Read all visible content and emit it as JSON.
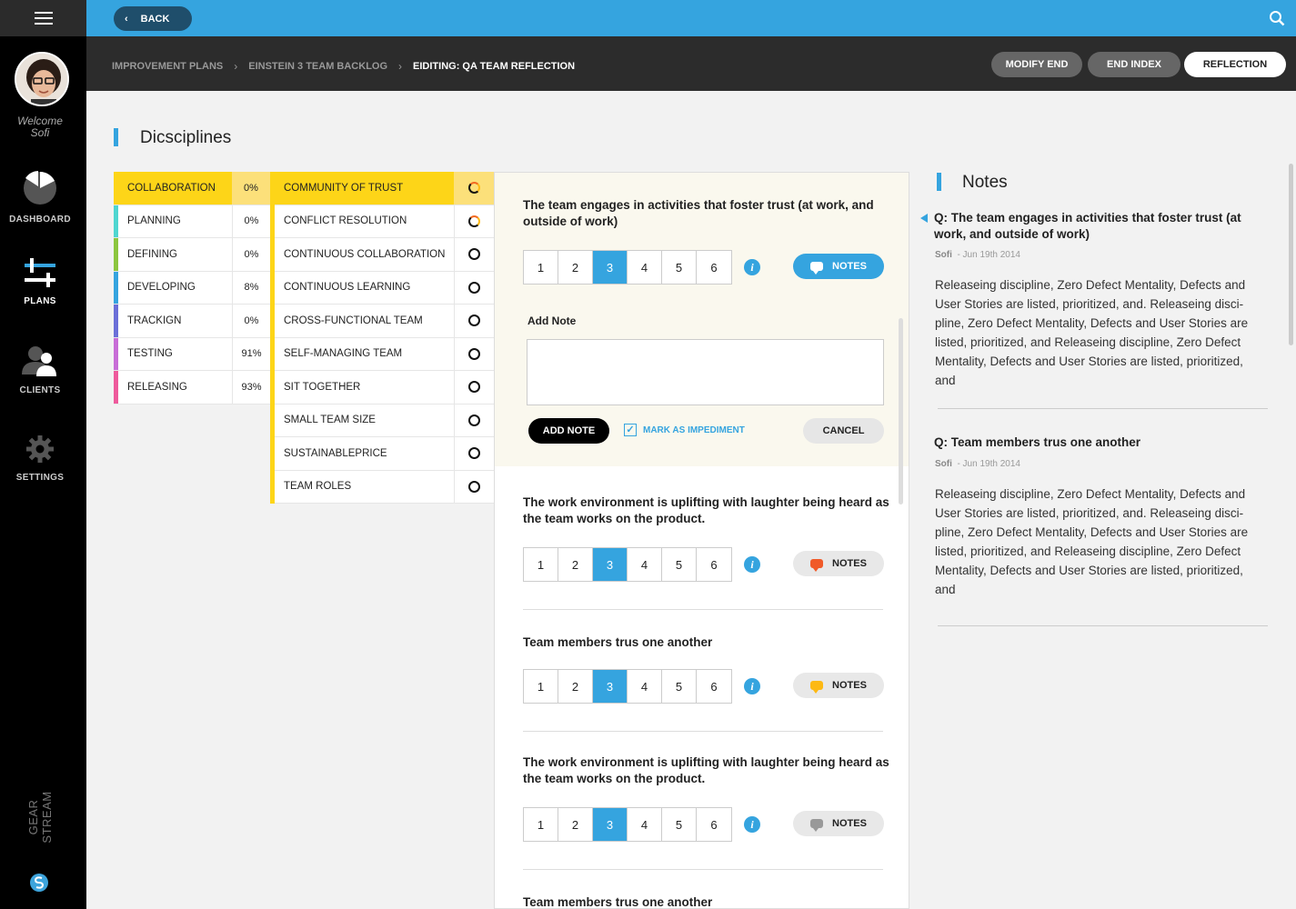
{
  "sidebar": {
    "welcome_line1": "Welcome",
    "welcome_line2": "Sofi",
    "items": [
      {
        "label": "DASHBOARD",
        "icon": "pie-chart-icon"
      },
      {
        "label": "PLANS",
        "icon": "sliders-icon",
        "active": true
      },
      {
        "label": "CLIENTS",
        "icon": "users-icon"
      },
      {
        "label": "SETTINGS",
        "icon": "gear-icon"
      }
    ],
    "brand": "GEAR STREAM"
  },
  "topbar": {
    "back_label": "BACK"
  },
  "breadcrumb": {
    "items": [
      "IMPROVEMENT PLANS",
      "EINSTEIN 3 TEAM BACKLOG",
      "EIDITING: QA TEAM REFLECTION"
    ]
  },
  "header_buttons": {
    "modify_end": "MODIFY END",
    "end_index": "END INDEX",
    "reflection": "REFLECTION"
  },
  "disciplines": {
    "title": "Dicsciplines",
    "items": [
      {
        "name": "COLLABORATION",
        "pct": "0%",
        "color": "#fdd518"
      },
      {
        "name": "PLANNING",
        "pct": "0%",
        "color": "#4fd6d0"
      },
      {
        "name": "DEFINING",
        "pct": "0%",
        "color": "#8cc63f"
      },
      {
        "name": "DEVELOPING",
        "pct": "8%",
        "color": "#35a4df"
      },
      {
        "name": "TRACKIGN",
        "pct": "0%",
        "color": "#6b6fd8"
      },
      {
        "name": "TESTING",
        "pct": "91%",
        "color": "#c86dd7"
      },
      {
        "name": "RELEASING",
        "pct": "93%",
        "color": "#ee5a9c"
      }
    ],
    "sub_items": [
      "COMMUNITY OF TRUST",
      "CONFLICT RESOLUTION",
      "CONTINUOUS COLLABORATION",
      "CONTINUOUS LEARNING",
      "CROSS-FUNCTIONAL TEAM",
      "SELF-MANAGING TEAM",
      "SIT TOGETHER",
      "SMALL TEAM SIZE",
      "SUSTAINABLEPRICE",
      "TEAM ROLES"
    ]
  },
  "questions": {
    "scale": [
      "1",
      "2",
      "3",
      "4",
      "5",
      "6"
    ],
    "selected": "3",
    "notes_label": "NOTES",
    "add_note_label": "Add Note",
    "add_note_button": "ADD NOTE",
    "impediment_label": "MARK AS IMPEDIMENT",
    "cancel_label": "CANCEL",
    "items": [
      {
        "text": "The team engages in activities that foster trust (at work, and outside of work)",
        "note_color": "#ffffff"
      },
      {
        "text": "The work environment is uplifting with laughter being heard as the team works on the product.",
        "note_color": "#f05a28"
      },
      {
        "text": "Team members trus one another",
        "note_color": "#fdb913"
      },
      {
        "text": "The work environment is uplifting with laughter being heard as the team works on the product.",
        "note_color": "#999999"
      },
      {
        "text": "Team members trus one another"
      }
    ]
  },
  "notes": {
    "title": "Notes",
    "items": [
      {
        "question": "Q: The team engages in activities that foster trust (at work, and outside of work)",
        "author": "Sofi",
        "date": "- Jun 19th 2014",
        "body": "Releaseing discipline, Zero Defect Mentality, Defects and User Stories are listed, prioritized, and. Releaseing disci-pline, Zero Defect Mentality, Defects and User Stories are listed, prioritized, and Releaseing discipline, Zero Defect Mentality, Defects and User Stories are listed, prioritized, and"
      },
      {
        "question": "Q: Team members trus one another",
        "author": "Sofi",
        "date": "- Jun 19th 2014",
        "body": "Releaseing discipline, Zero Defect Mentality, Defects and User Stories are listed, prioritized, and. Releaseing disci-pline, Zero Defect Mentality, Defects and User Stories are listed, prioritized, and Releaseing discipline, Zero Defect Mentality, Defects and User Stories are listed, prioritized, and"
      }
    ]
  },
  "colors": {
    "accent": "#35a4df",
    "highlight": "#fdd518",
    "sidebar": "#000000",
    "header": "#2c2c2c"
  }
}
